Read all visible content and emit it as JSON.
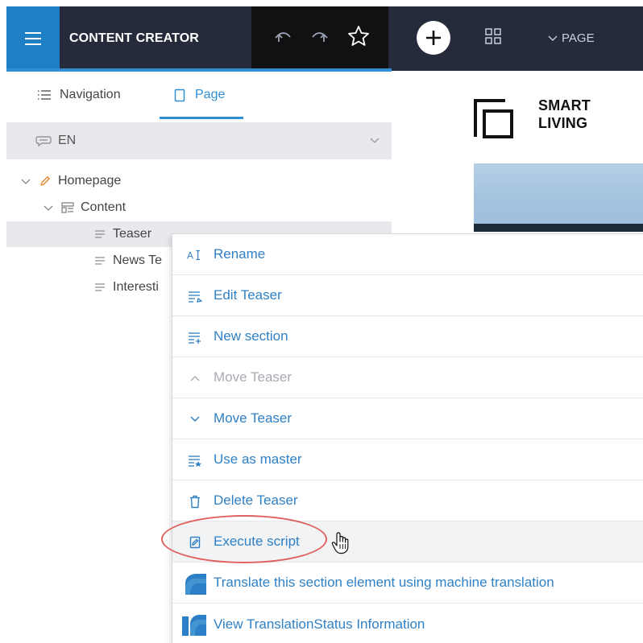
{
  "app": {
    "title": "CONTENT CREATOR",
    "page_dropdown": "PAGE",
    "accent_color": "#2f8ed4",
    "topbar_color": "#252b3b"
  },
  "toolbar": {
    "icons": [
      "menu-icon",
      "undo-icon",
      "redo-icon",
      "star-icon",
      "add-icon",
      "grid-icon",
      "chevron-down-icon"
    ]
  },
  "sidebar": {
    "tabs": [
      {
        "label": "Navigation",
        "icon": "list-icon",
        "active": false
      },
      {
        "label": "Page",
        "icon": "page-icon",
        "active": true
      }
    ],
    "language": "EN",
    "tree": [
      {
        "label": "Homepage",
        "icon": "pencil-icon",
        "level": 0
      },
      {
        "label": "Content",
        "icon": "layout-icon",
        "level": 1
      },
      {
        "label": "Teaser",
        "icon": "lines-icon",
        "level": 2,
        "selected": true
      },
      {
        "label": "News Te",
        "icon": "lines-icon",
        "level": 2
      },
      {
        "label": "Interesti",
        "icon": "lines-icon",
        "level": 2
      }
    ]
  },
  "preview": {
    "logo_line1": "SMART",
    "logo_line2": "LIVING"
  },
  "context_menu": {
    "items": [
      {
        "label": "Rename",
        "icon": "rename-icon",
        "disabled": false
      },
      {
        "label": "Edit Teaser",
        "icon": "edit-section-icon",
        "disabled": false
      },
      {
        "label": "New section",
        "icon": "new-section-icon",
        "disabled": false
      },
      {
        "label": "Move Teaser",
        "icon": "chevron-up-icon",
        "disabled": true
      },
      {
        "label": "Move Teaser",
        "icon": "chevron-down-icon",
        "disabled": false
      },
      {
        "label": "Use as master",
        "icon": "master-icon",
        "disabled": false
      },
      {
        "label": "Delete Teaser",
        "icon": "trash-icon",
        "disabled": false
      },
      {
        "label": "Execute script",
        "icon": "script-icon",
        "disabled": false,
        "hovered": true
      },
      {
        "label": "Translate this section element using machine translation",
        "icon": "translate-icon",
        "disabled": false
      },
      {
        "label": "View TranslationStatus Information",
        "icon": "translation-status-icon",
        "disabled": false
      }
    ]
  }
}
